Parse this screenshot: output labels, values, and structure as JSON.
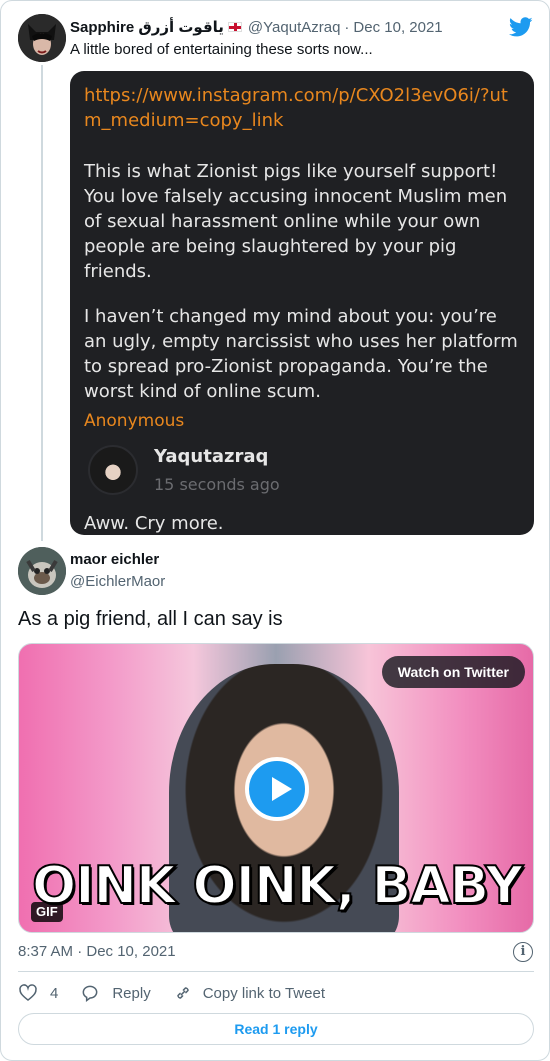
{
  "parent_tweet": {
    "display_name": "Sapphire ياقوت أزرق",
    "handle": "@YaqutAzraq",
    "separator": "·",
    "date": "Dec 10, 2021",
    "text": "A little bored of entertaining these sorts now...",
    "embedded_screenshot": {
      "link": "https://www.instagram.com/p/CXO2l3evO6i/?utm_medium=copy_link",
      "paragraph_1": "This is what Zionist pigs like yourself support! You love falsely accusing innocent Muslim men of sexual harassment online while your own people are being slaughtered by your pig friends.",
      "paragraph_2": "I haven’t changed my mind about you: you’re an ugly, empty narcissist who uses her platform to spread pro-Zionist propaganda. You’re the worst kind of online scum.",
      "sender": "Anonymous",
      "reply_user": "Yaqutazraq",
      "reply_time": "15 seconds ago",
      "reply_text": "Aww. Cry more."
    }
  },
  "reply_tweet": {
    "display_name": "maor eichler",
    "handle": "@EichlerMaor",
    "text": "As a pig friend, all I can say is",
    "media": {
      "caption": "OINK OINK, BABY",
      "watch_label": "Watch on Twitter",
      "badge": "GIF"
    },
    "timestamp": "8:37 AM · Dec 10, 2021",
    "actions": {
      "like_count": "4",
      "reply_label": "Reply",
      "share_label": "Copy link to Tweet"
    },
    "read_replies_label": "Read 1 reply"
  },
  "icons": {
    "brand": "twitter-bird-icon",
    "info": "info-icon",
    "like": "heart-icon",
    "reply": "reply-bubble-icon",
    "share": "link-icon"
  },
  "colors": {
    "accent": "#1d9bf0",
    "secondary_text": "#536471",
    "embed_bg": "#1f2023",
    "embed_accent": "#e8871e"
  }
}
